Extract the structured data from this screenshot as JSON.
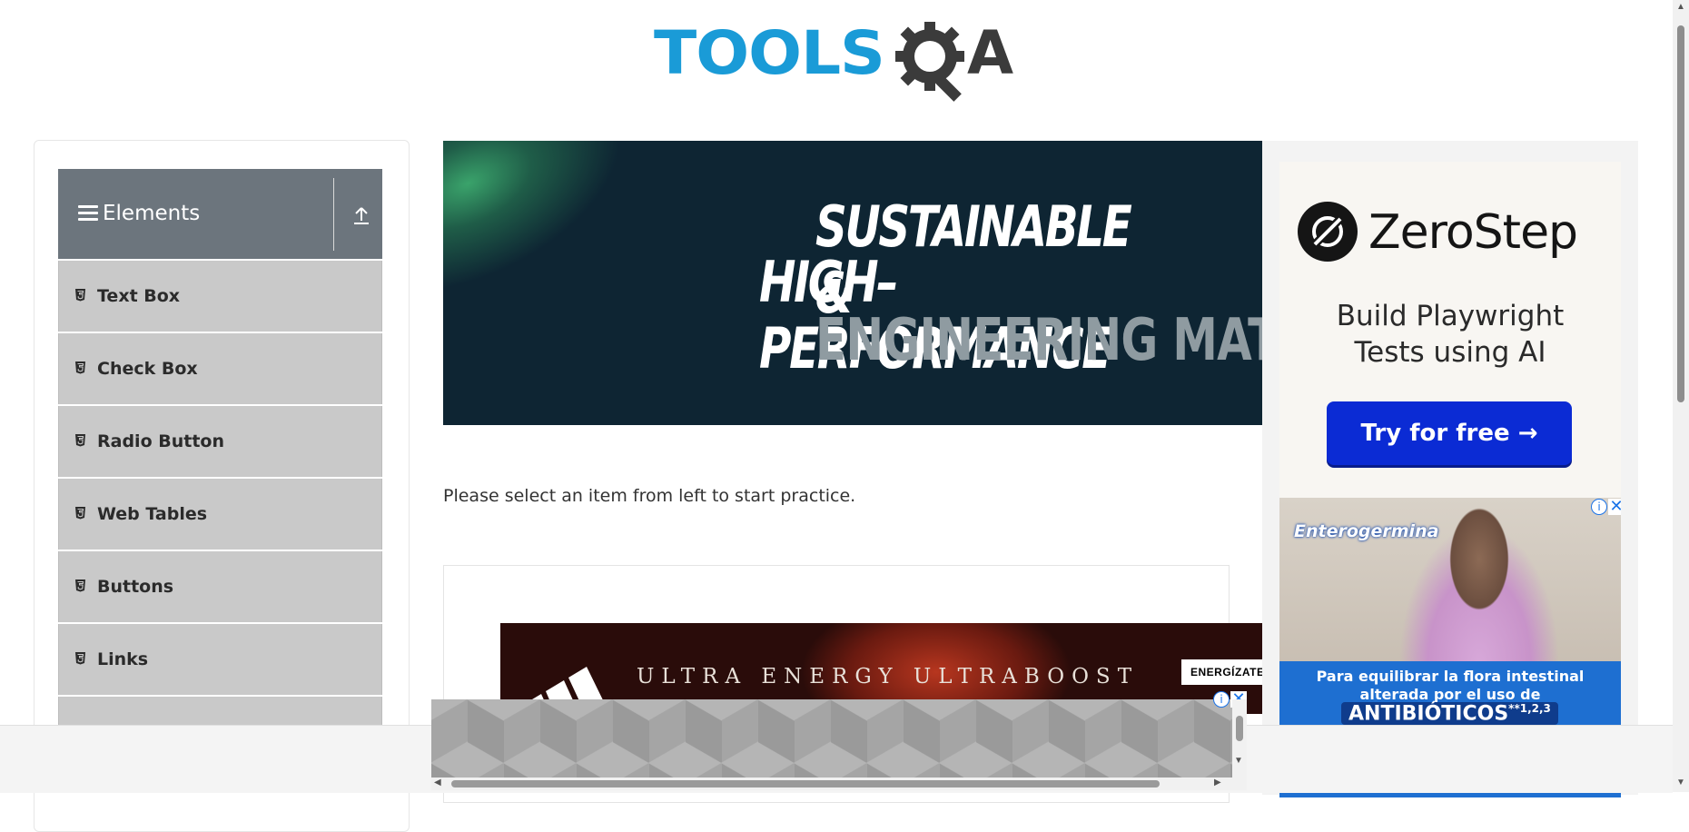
{
  "header": {
    "logo_tools": "TOOLS",
    "logo_a": "A"
  },
  "sidebar": {
    "group_title": "Elements",
    "items": [
      {
        "label": "Text Box"
      },
      {
        "label": "Check Box"
      },
      {
        "label": "Radio Button"
      },
      {
        "label": "Web Tables"
      },
      {
        "label": "Buttons"
      },
      {
        "label": "Links"
      },
      {
        "label": ""
      }
    ]
  },
  "banner_ad": {
    "line1": "SUSTAINABLE &",
    "line2": "HIGH–PERFORMANCE",
    "line3": "ENGINEERING MATERIA"
  },
  "main": {
    "instruction": "Please select an item from left to start practice."
  },
  "inner_ad": {
    "tagline": "ULTRA ENERGY  ULTRABOOST",
    "cta": "ENERGÍZATE"
  },
  "right_ad": {
    "brand": "ZeroStep",
    "subtitle_line1": "Build Playwright",
    "subtitle_line2": "Tests using AI",
    "cta": "Try for free →"
  },
  "right_ad2": {
    "brand": "Enterogermina",
    "msg_line1": "Para equilibrar la flora intestinal",
    "msg_line2": "alterada por el uso de",
    "highlight": "ANTIBIÓTICOS",
    "superscript": "**1,2,3"
  },
  "ad_controls": {
    "info": "i",
    "close": "✕"
  },
  "colors": {
    "logo_blue": "#1a9bd7",
    "logo_dark": "#3b3b3b",
    "sidebar_header": "#6c757d",
    "sidebar_item": "#c9c9c9",
    "cta_blue": "#0b2bd4"
  }
}
